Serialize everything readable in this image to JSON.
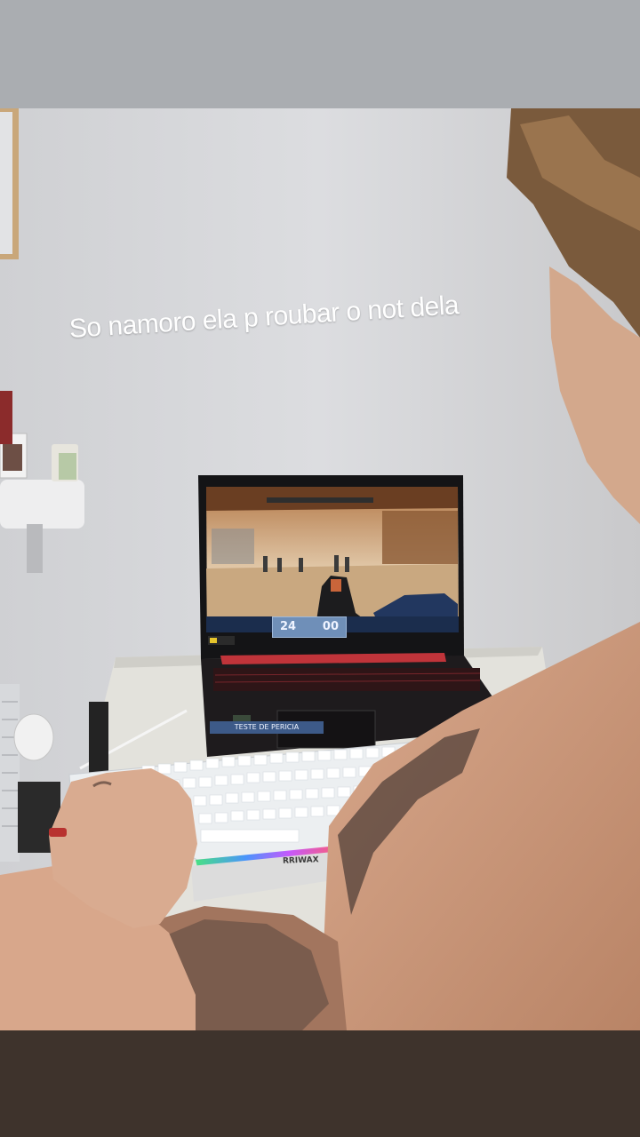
{
  "story": {
    "caption": "So namoro ela p roubar o not dela"
  },
  "game_screen": {
    "score_left": "24",
    "score_right": "00",
    "banner_text": "TESTE DE PERICIA"
  },
  "keyboard": {
    "brand": "RRIWAX"
  },
  "colors": {
    "top_band": "#aaadb1",
    "bottom_band": "#3e332c",
    "wall": "#d5d6d8",
    "laptop_accent": "#c0343a"
  }
}
